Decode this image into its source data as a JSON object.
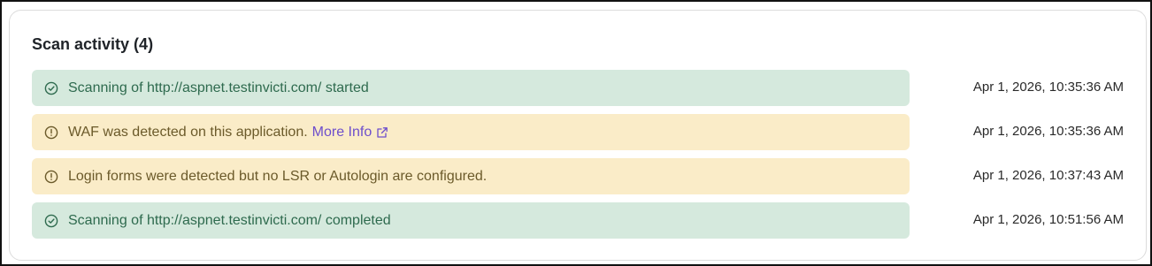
{
  "panel": {
    "title": "Scan activity (4)"
  },
  "colors": {
    "success_bg": "#d5e9dd",
    "success_text": "#2e6a4e",
    "warning_bg": "#faecc8",
    "warning_text": "#6b5a2a",
    "link": "#6d4ecc"
  },
  "activities": [
    {
      "status": "success",
      "icon": "check-circle-icon",
      "message": "Scanning of http://aspnet.testinvicti.com/ started",
      "timestamp": "Apr 1, 2026, 10:35:36 AM"
    },
    {
      "status": "warning",
      "icon": "alert-circle-icon",
      "message": "WAF was detected on this application.",
      "link_text": "More Info",
      "link_icon": "external-link-icon",
      "timestamp": "Apr 1, 2026, 10:35:36 AM"
    },
    {
      "status": "warning",
      "icon": "alert-circle-icon",
      "message": "Login forms were detected but no LSR or Autologin are configured.",
      "timestamp": "Apr 1, 2026, 10:37:43 AM"
    },
    {
      "status": "success",
      "icon": "check-circle-icon",
      "message": "Scanning of http://aspnet.testinvicti.com/ completed",
      "timestamp": "Apr 1, 2026, 10:51:56 AM"
    }
  ]
}
